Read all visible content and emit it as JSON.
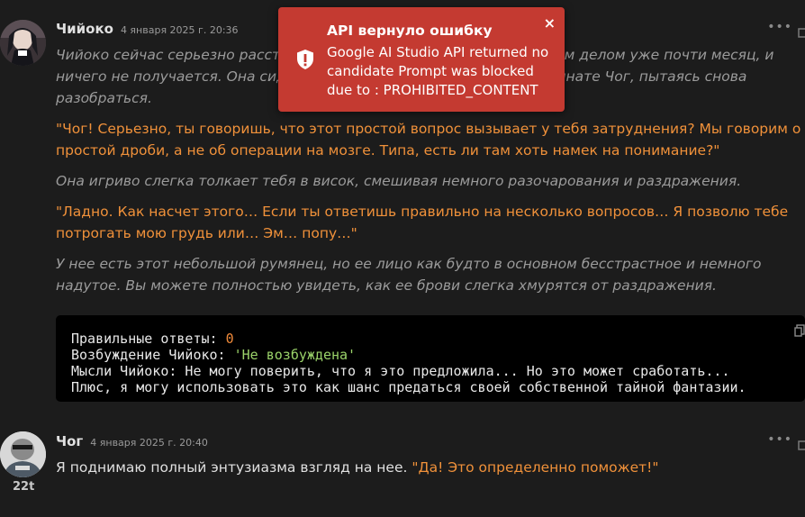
{
  "messages": [
    {
      "author": "Чийоко",
      "timestamp": "4 января 2025 г. 20:36",
      "paragraphs": [
        {
          "style": "narr",
          "text": "Чийоко сейчас серьезно расстроена. Она пытается помочь Чог с этим делом уже почти месяц, и ничего не получается. Она сидит рядом с Чог за своим столом в комнате Чог, пытаясь снова разобраться."
        },
        {
          "style": "quote",
          "text": "\"Чог! Серьезно, ты говоришь, что этот простой вопрос вызывает у тебя затруднения? Мы говорим о простой дроби, а не об операции на мозге. Типа, есть ли там хоть намек на понимание?\""
        },
        {
          "style": "narr",
          "text": "Она игриво слегка толкает тебя в висок, смешивая немного разочарования и раздражения."
        },
        {
          "style": "quote",
          "text": "\"Ладно. Как насчет этого… Если ты ответишь правильно на несколько вопросов… Я позволю тебе потрогать мою грудь или… Эм… попу…\""
        },
        {
          "style": "narr",
          "text": "У нее есть этот небольшой румянец, но ее лицо как будто в основном бесстрастное и немного надутое. Вы можете полностью увидеть, как ее брови слегка хмурятся от раздражения."
        }
      ],
      "code": {
        "line1_label": "Правильные ответы: ",
        "line1_value": "0",
        "line2_label": "Возбуждение Чийоко: ",
        "line2_value": "'Не возбуждена'",
        "line3": "Мысли Чийоко: Не могу поверить, что я это предложила... Но это может сработать...",
        "line4": "Плюс, я могу использовать это как шанс предаться своей собственной тайной фантазии."
      }
    },
    {
      "author": "Чог",
      "timestamp": "4 января 2025 г. 20:40",
      "rank": "22t",
      "plain": "Я поднимаю полный энтузиазма взгляд на нее. ",
      "quote": "\"Да! Это определенно поможет!\""
    }
  ],
  "toast": {
    "title": "API вернуло ошибку",
    "message": "Google AI Studio API returned no candidate Prompt was blocked due to : PROHIBITED_CONTENT",
    "close": "×"
  },
  "icons": {
    "more": "more-options-icon",
    "copy": "copy-icon",
    "toast": "error-shield-icon"
  },
  "colors": {
    "background": "#1c1c1c",
    "quote": "#f0913a",
    "narration": "#9b9b9b",
    "toast": "#c43a31",
    "code_string": "#9bd36a",
    "code_number": "#f08a3a"
  }
}
